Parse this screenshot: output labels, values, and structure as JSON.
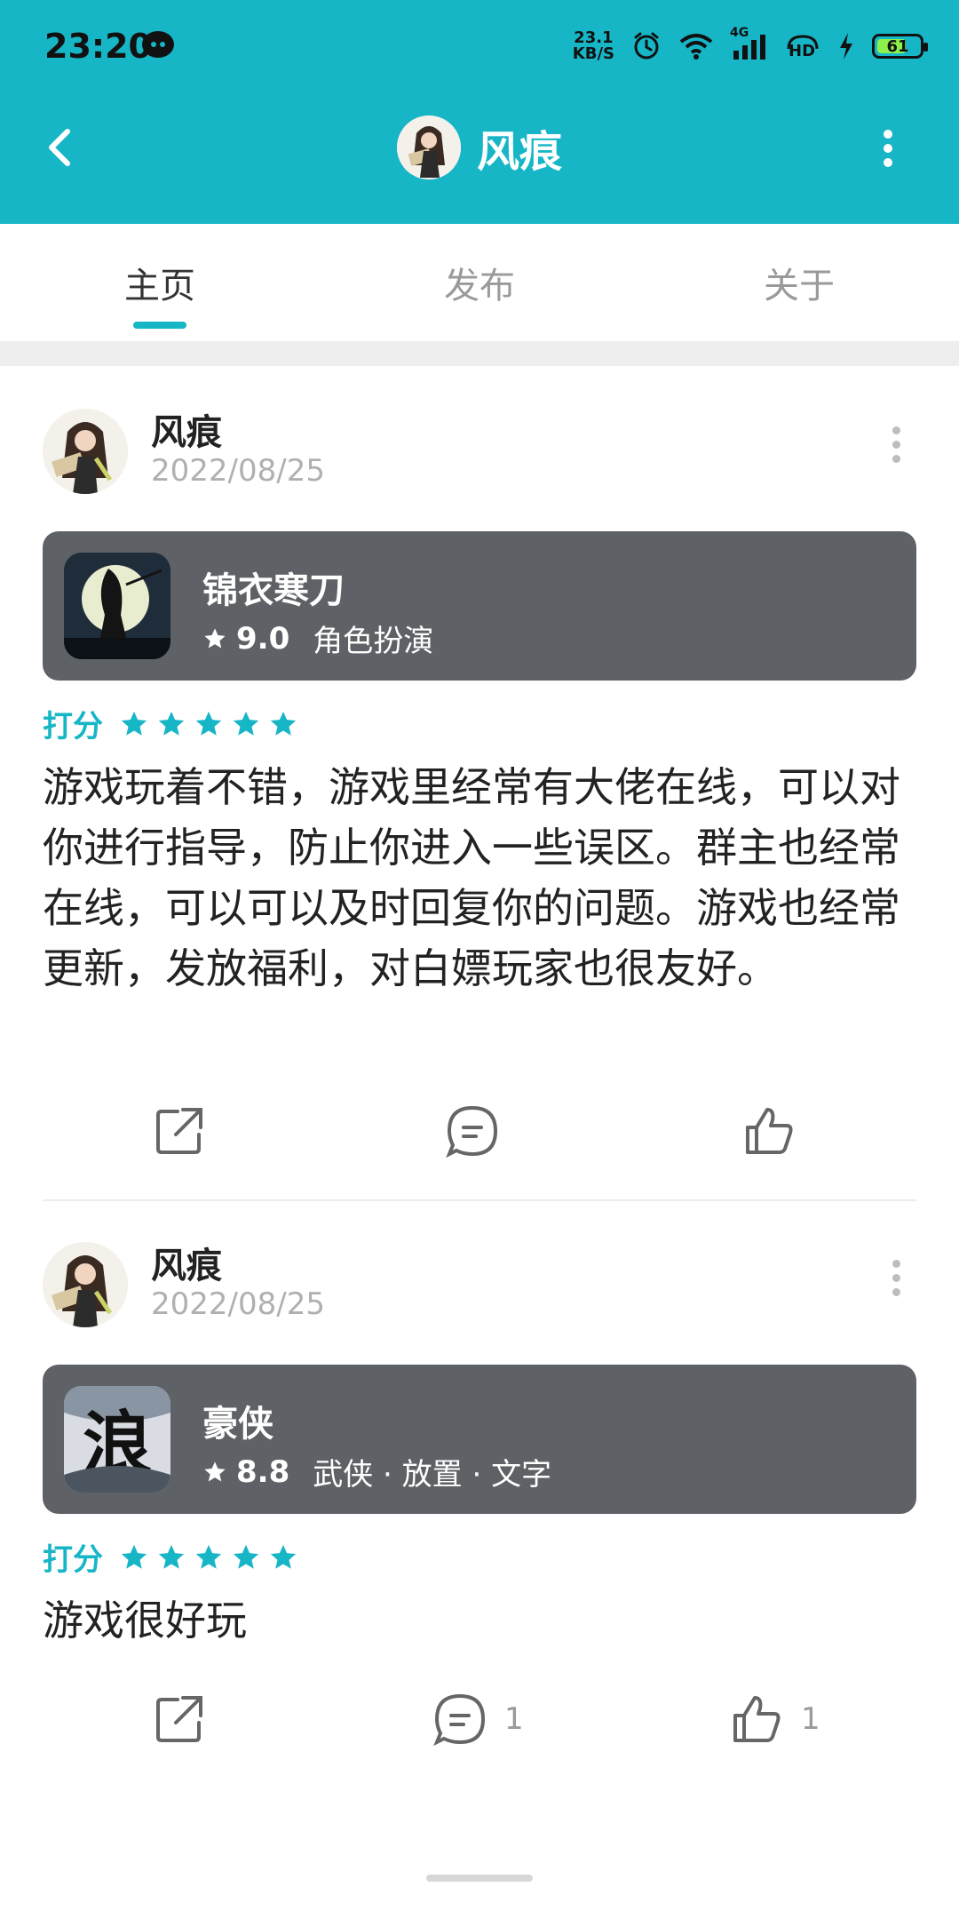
{
  "status_bar": {
    "time": "23:20",
    "net_speed_value": "23.1",
    "net_speed_unit": "KB/S",
    "network": "4G",
    "hd_label": "HD",
    "battery": "61",
    "icons": [
      "chat-icon",
      "alarm-icon",
      "wifi-icon",
      "signal-icon",
      "hd-icon",
      "charging-icon",
      "battery-icon"
    ]
  },
  "header": {
    "title": "风痕",
    "back_icon": "chevron-left-icon",
    "more_icon": "more-vertical-icon"
  },
  "tabs": [
    {
      "label": "主页",
      "active": true
    },
    {
      "label": "发布",
      "active": false
    },
    {
      "label": "关于",
      "active": false
    }
  ],
  "posts": [
    {
      "user": "风痕",
      "date": "2022/08/25",
      "game": {
        "name": "锦衣寒刀",
        "rating": "9.0",
        "tags": "角色扮演"
      },
      "score_label": "打分",
      "stars": 5,
      "body": "游戏玩着不错，游戏里经常有大佬在线，可以对你进行指导，防止你进入一些误区。群主也经常在线，可以可以及时回复你的问题。游戏也经常更新，发放福利，对白嫖玩家也很友好。",
      "comment_count": "",
      "like_count": ""
    },
    {
      "user": "风痕",
      "date": "2022/08/25",
      "game": {
        "name": "豪侠",
        "rating": "8.8",
        "tags": "武侠 · 放置 · 文字"
      },
      "score_label": "打分",
      "stars": 5,
      "body": "游戏很好玩",
      "comment_count": "1",
      "like_count": "1"
    }
  ],
  "colors": {
    "accent": "#17b6c7",
    "card_bg": "#5e6165",
    "text_primary": "#222222",
    "text_secondary": "#b0b0b0"
  }
}
